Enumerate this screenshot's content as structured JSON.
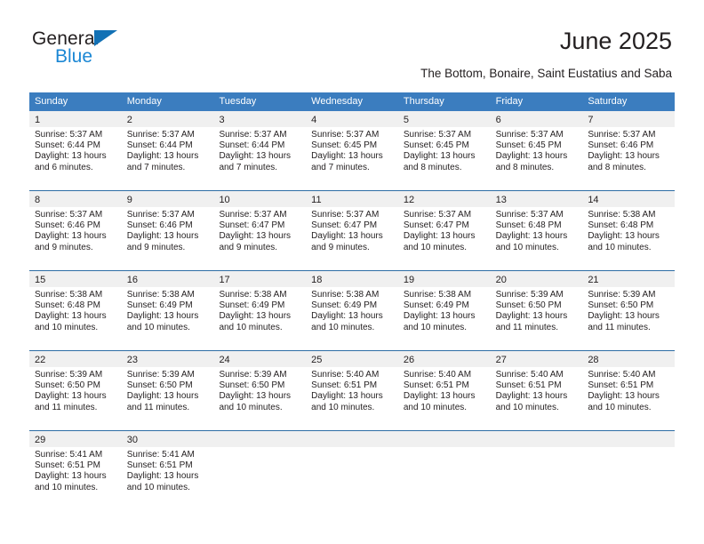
{
  "brand": {
    "name_part1": "General",
    "name_part2": "Blue",
    "triangle_color": "#1271b5",
    "blue_color": "#1b87d4"
  },
  "header": {
    "title": "June 2025",
    "subtitle": "The Bottom, Bonaire, Saint Eustatius and Saba"
  },
  "theme": {
    "header_blue": "#3b7dbf",
    "separator_blue": "#2e6da4",
    "day_band_gray": "#f0f0f0",
    "text_color": "#231f20"
  },
  "calendar": {
    "weekdays": [
      "Sunday",
      "Monday",
      "Tuesday",
      "Wednesday",
      "Thursday",
      "Friday",
      "Saturday"
    ],
    "weeks": [
      [
        {
          "day": "1",
          "sunrise": "Sunrise: 5:37 AM",
          "sunset": "Sunset: 6:44 PM",
          "daylight": "Daylight: 13 hours and 6 minutes."
        },
        {
          "day": "2",
          "sunrise": "Sunrise: 5:37 AM",
          "sunset": "Sunset: 6:44 PM",
          "daylight": "Daylight: 13 hours and 7 minutes."
        },
        {
          "day": "3",
          "sunrise": "Sunrise: 5:37 AM",
          "sunset": "Sunset: 6:44 PM",
          "daylight": "Daylight: 13 hours and 7 minutes."
        },
        {
          "day": "4",
          "sunrise": "Sunrise: 5:37 AM",
          "sunset": "Sunset: 6:45 PM",
          "daylight": "Daylight: 13 hours and 7 minutes."
        },
        {
          "day": "5",
          "sunrise": "Sunrise: 5:37 AM",
          "sunset": "Sunset: 6:45 PM",
          "daylight": "Daylight: 13 hours and 8 minutes."
        },
        {
          "day": "6",
          "sunrise": "Sunrise: 5:37 AM",
          "sunset": "Sunset: 6:45 PM",
          "daylight": "Daylight: 13 hours and 8 minutes."
        },
        {
          "day": "7",
          "sunrise": "Sunrise: 5:37 AM",
          "sunset": "Sunset: 6:46 PM",
          "daylight": "Daylight: 13 hours and 8 minutes."
        }
      ],
      [
        {
          "day": "8",
          "sunrise": "Sunrise: 5:37 AM",
          "sunset": "Sunset: 6:46 PM",
          "daylight": "Daylight: 13 hours and 9 minutes."
        },
        {
          "day": "9",
          "sunrise": "Sunrise: 5:37 AM",
          "sunset": "Sunset: 6:46 PM",
          "daylight": "Daylight: 13 hours and 9 minutes."
        },
        {
          "day": "10",
          "sunrise": "Sunrise: 5:37 AM",
          "sunset": "Sunset: 6:47 PM",
          "daylight": "Daylight: 13 hours and 9 minutes."
        },
        {
          "day": "11",
          "sunrise": "Sunrise: 5:37 AM",
          "sunset": "Sunset: 6:47 PM",
          "daylight": "Daylight: 13 hours and 9 minutes."
        },
        {
          "day": "12",
          "sunrise": "Sunrise: 5:37 AM",
          "sunset": "Sunset: 6:47 PM",
          "daylight": "Daylight: 13 hours and 10 minutes."
        },
        {
          "day": "13",
          "sunrise": "Sunrise: 5:37 AM",
          "sunset": "Sunset: 6:48 PM",
          "daylight": "Daylight: 13 hours and 10 minutes."
        },
        {
          "day": "14",
          "sunrise": "Sunrise: 5:38 AM",
          "sunset": "Sunset: 6:48 PM",
          "daylight": "Daylight: 13 hours and 10 minutes."
        }
      ],
      [
        {
          "day": "15",
          "sunrise": "Sunrise: 5:38 AM",
          "sunset": "Sunset: 6:48 PM",
          "daylight": "Daylight: 13 hours and 10 minutes."
        },
        {
          "day": "16",
          "sunrise": "Sunrise: 5:38 AM",
          "sunset": "Sunset: 6:49 PM",
          "daylight": "Daylight: 13 hours and 10 minutes."
        },
        {
          "day": "17",
          "sunrise": "Sunrise: 5:38 AM",
          "sunset": "Sunset: 6:49 PM",
          "daylight": "Daylight: 13 hours and 10 minutes."
        },
        {
          "day": "18",
          "sunrise": "Sunrise: 5:38 AM",
          "sunset": "Sunset: 6:49 PM",
          "daylight": "Daylight: 13 hours and 10 minutes."
        },
        {
          "day": "19",
          "sunrise": "Sunrise: 5:38 AM",
          "sunset": "Sunset: 6:49 PM",
          "daylight": "Daylight: 13 hours and 10 minutes."
        },
        {
          "day": "20",
          "sunrise": "Sunrise: 5:39 AM",
          "sunset": "Sunset: 6:50 PM",
          "daylight": "Daylight: 13 hours and 11 minutes."
        },
        {
          "day": "21",
          "sunrise": "Sunrise: 5:39 AM",
          "sunset": "Sunset: 6:50 PM",
          "daylight": "Daylight: 13 hours and 11 minutes."
        }
      ],
      [
        {
          "day": "22",
          "sunrise": "Sunrise: 5:39 AM",
          "sunset": "Sunset: 6:50 PM",
          "daylight": "Daylight: 13 hours and 11 minutes."
        },
        {
          "day": "23",
          "sunrise": "Sunrise: 5:39 AM",
          "sunset": "Sunset: 6:50 PM",
          "daylight": "Daylight: 13 hours and 11 minutes."
        },
        {
          "day": "24",
          "sunrise": "Sunrise: 5:39 AM",
          "sunset": "Sunset: 6:50 PM",
          "daylight": "Daylight: 13 hours and 10 minutes."
        },
        {
          "day": "25",
          "sunrise": "Sunrise: 5:40 AM",
          "sunset": "Sunset: 6:51 PM",
          "daylight": "Daylight: 13 hours and 10 minutes."
        },
        {
          "day": "26",
          "sunrise": "Sunrise: 5:40 AM",
          "sunset": "Sunset: 6:51 PM",
          "daylight": "Daylight: 13 hours and 10 minutes."
        },
        {
          "day": "27",
          "sunrise": "Sunrise: 5:40 AM",
          "sunset": "Sunset: 6:51 PM",
          "daylight": "Daylight: 13 hours and 10 minutes."
        },
        {
          "day": "28",
          "sunrise": "Sunrise: 5:40 AM",
          "sunset": "Sunset: 6:51 PM",
          "daylight": "Daylight: 13 hours and 10 minutes."
        }
      ],
      [
        {
          "day": "29",
          "sunrise": "Sunrise: 5:41 AM",
          "sunset": "Sunset: 6:51 PM",
          "daylight": "Daylight: 13 hours and 10 minutes."
        },
        {
          "day": "30",
          "sunrise": "Sunrise: 5:41 AM",
          "sunset": "Sunset: 6:51 PM",
          "daylight": "Daylight: 13 hours and 10 minutes."
        },
        {
          "day": "",
          "sunrise": "",
          "sunset": "",
          "daylight": ""
        },
        {
          "day": "",
          "sunrise": "",
          "sunset": "",
          "daylight": ""
        },
        {
          "day": "",
          "sunrise": "",
          "sunset": "",
          "daylight": ""
        },
        {
          "day": "",
          "sunrise": "",
          "sunset": "",
          "daylight": ""
        },
        {
          "day": "",
          "sunrise": "",
          "sunset": "",
          "daylight": ""
        }
      ]
    ]
  }
}
